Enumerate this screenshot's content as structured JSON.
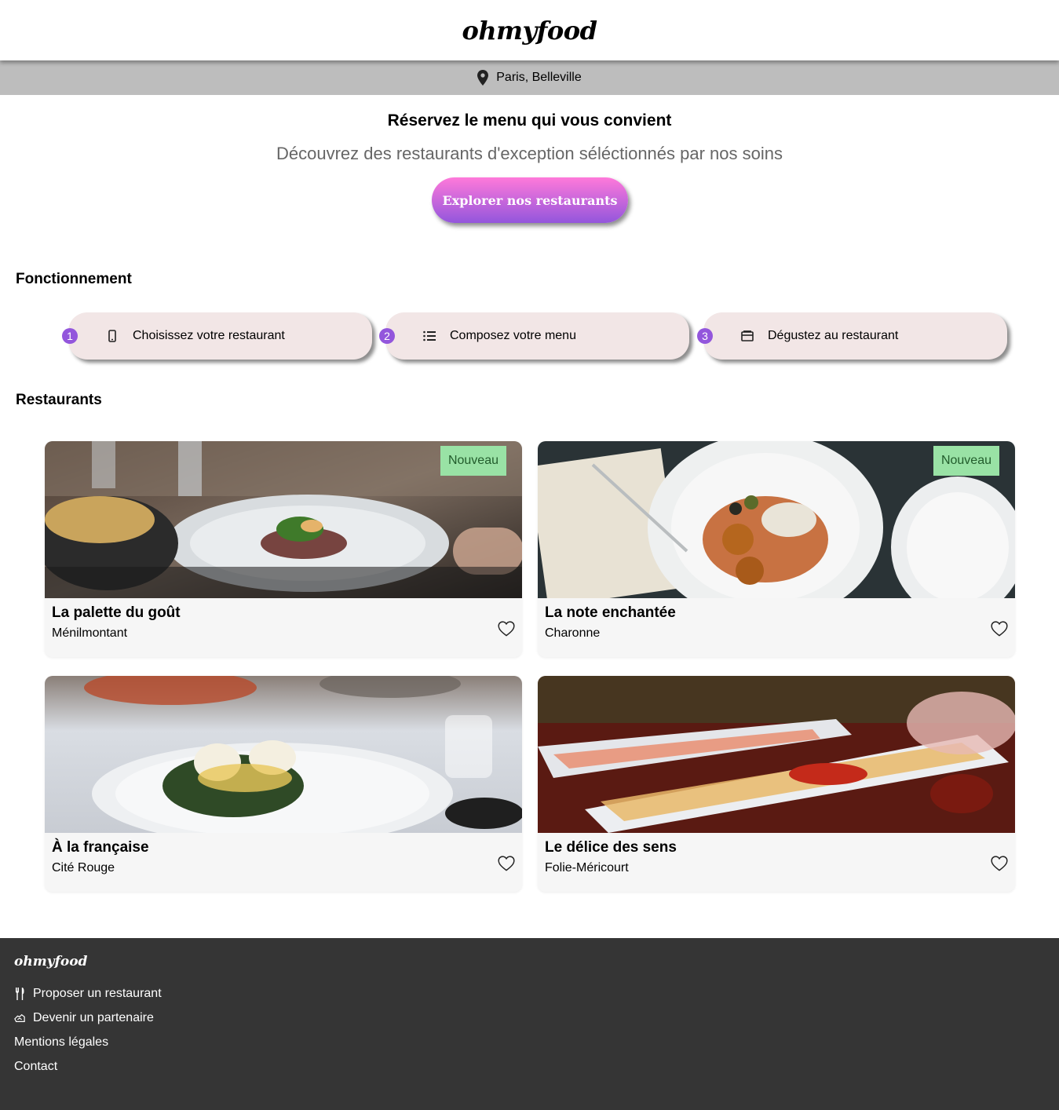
{
  "header": {
    "logo": "ohmyfood"
  },
  "location": {
    "text": "Paris, Belleville",
    "icon": "location-pin-icon"
  },
  "hero": {
    "title": "Réservez le menu qui vous convient",
    "subtitle": "Découvrez des restaurants d'exception séléctionnés par nos soins",
    "cta_label": "Explorer nos restaurants"
  },
  "how_it_works": {
    "title": "Fonctionnement",
    "steps": [
      {
        "number": "1",
        "label": "Choisissez votre restaurant",
        "icon": "mobile-phone-icon"
      },
      {
        "number": "2",
        "label": "Composez votre menu",
        "icon": "list-icon"
      },
      {
        "number": "3",
        "label": "Dégustez au restaurant",
        "icon": "receipt-icon"
      }
    ]
  },
  "restaurants": {
    "title": "Restaurants",
    "items": [
      {
        "name": "La palette du goût",
        "area": "Ménilmontant",
        "badge": "Nouveau"
      },
      {
        "name": "La note enchantée",
        "area": "Charonne",
        "badge": "Nouveau"
      },
      {
        "name": "À la française",
        "area": "Cité Rouge"
      },
      {
        "name": "Le délice des sens",
        "area": "Folie-Méricourt"
      }
    ]
  },
  "footer": {
    "logo": "ohmyfood",
    "links": [
      {
        "label": "Proposer un restaurant",
        "icon": "utensils-icon"
      },
      {
        "label": "Devenir un partenaire",
        "icon": "handshake-icon"
      },
      {
        "label": "Mentions légales"
      },
      {
        "label": "Contact"
      }
    ]
  },
  "colors": {
    "accent_purple": "#9356dc",
    "accent_pink": "#ff79da",
    "step_bg": "#f2e6e6",
    "badge_bg": "#99e2a5",
    "footer_bg": "#353535"
  }
}
